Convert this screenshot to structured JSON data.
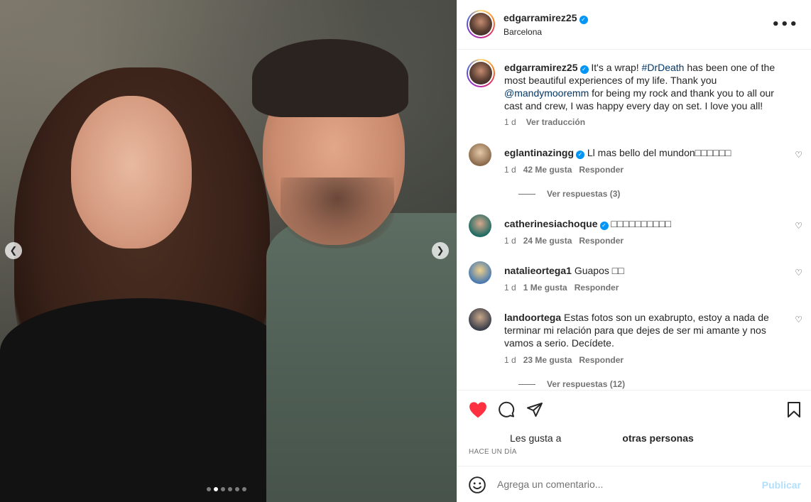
{
  "post": {
    "username": "edgarramirez25",
    "location": "Barcelona",
    "caption_text_1": " It's a wrap! ",
    "hashtag": "#DrDeath",
    "caption_text_2": " has been one of the most beautiful experiences of my life. Thank you ",
    "mention": "@mandymooremm",
    "caption_text_3": " for being my rock and thank you to all our cast and crew, I was happy every day on set. I love you all!",
    "caption_time": "1 d",
    "translate_label": "Ver traducción"
  },
  "comments": [
    {
      "username": "eglantinazingg",
      "verified": true,
      "text": "Ll mas bello del mundon□□□□□□",
      "time": "1 d",
      "likes": "42 Me gusta",
      "reply": "Responder",
      "replies": "Ver respuestas (3)"
    },
    {
      "username": "catherinesiachoque",
      "verified": true,
      "text": "□□□□□□□□□□",
      "time": "1 d",
      "likes": "24 Me gusta",
      "reply": "Responder"
    },
    {
      "username": "natalieortega1",
      "verified": false,
      "text": "Guapos □□",
      "time": "1 d",
      "likes": "1 Me gusta",
      "reply": "Responder"
    },
    {
      "username": "landoortega",
      "verified": false,
      "text": "Estas fotos son un exabrupto, estoy a nada de terminar mi relación para que dejes de ser mi amante y nos vamos a serio. Decídete.",
      "time": "1 d",
      "likes": "23 Me gusta",
      "reply": "Responder",
      "replies": "Ver respuestas (12)"
    }
  ],
  "likes_bar": {
    "prefix": "Les gusta a",
    "suffix": "otras personas"
  },
  "posted_time": "HACE UN DÍA",
  "comment_box": {
    "placeholder": "Agrega un comentario...",
    "publish_label": "Publicar"
  },
  "carousel": {
    "slide_count": 6,
    "active_index": 1
  },
  "icons": {
    "like": "heart-filled-icon",
    "comment": "comment-icon",
    "share": "share-icon",
    "save": "bookmark-icon",
    "emoji": "emoji-icon",
    "more": "more-options-icon"
  },
  "colors": {
    "liked": "#ff3040",
    "link": "#00376b",
    "verified": "#0095f6",
    "publish_disabled": "#b2dffc"
  }
}
